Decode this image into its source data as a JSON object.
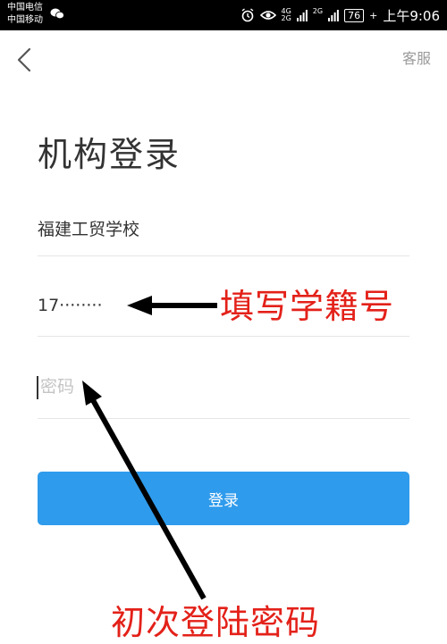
{
  "status_bar": {
    "carrier_1": "中国电信",
    "carrier_2": "中国移动",
    "net_top": "4G",
    "net_bottom": "2G",
    "net2": "2G",
    "battery": "76",
    "time": "上午9:06",
    "icons": [
      "wechat-icon",
      "alarm-icon",
      "eye-icon",
      "signal-icon",
      "battery-icon"
    ]
  },
  "header": {
    "back_icon": "chevron-left-icon",
    "support_label": "客服"
  },
  "login": {
    "title": "机构登录",
    "school": "福建工贸学校",
    "student_id_value": "17········",
    "password_placeholder": "密码",
    "submit_label": "登录"
  },
  "annotations": {
    "student_id_hint": "填写学籍号",
    "password_hint": "初次登陆密码"
  },
  "colors": {
    "accent": "#2f9bec",
    "annotation": "#e32119",
    "status_bar": "#000000"
  }
}
